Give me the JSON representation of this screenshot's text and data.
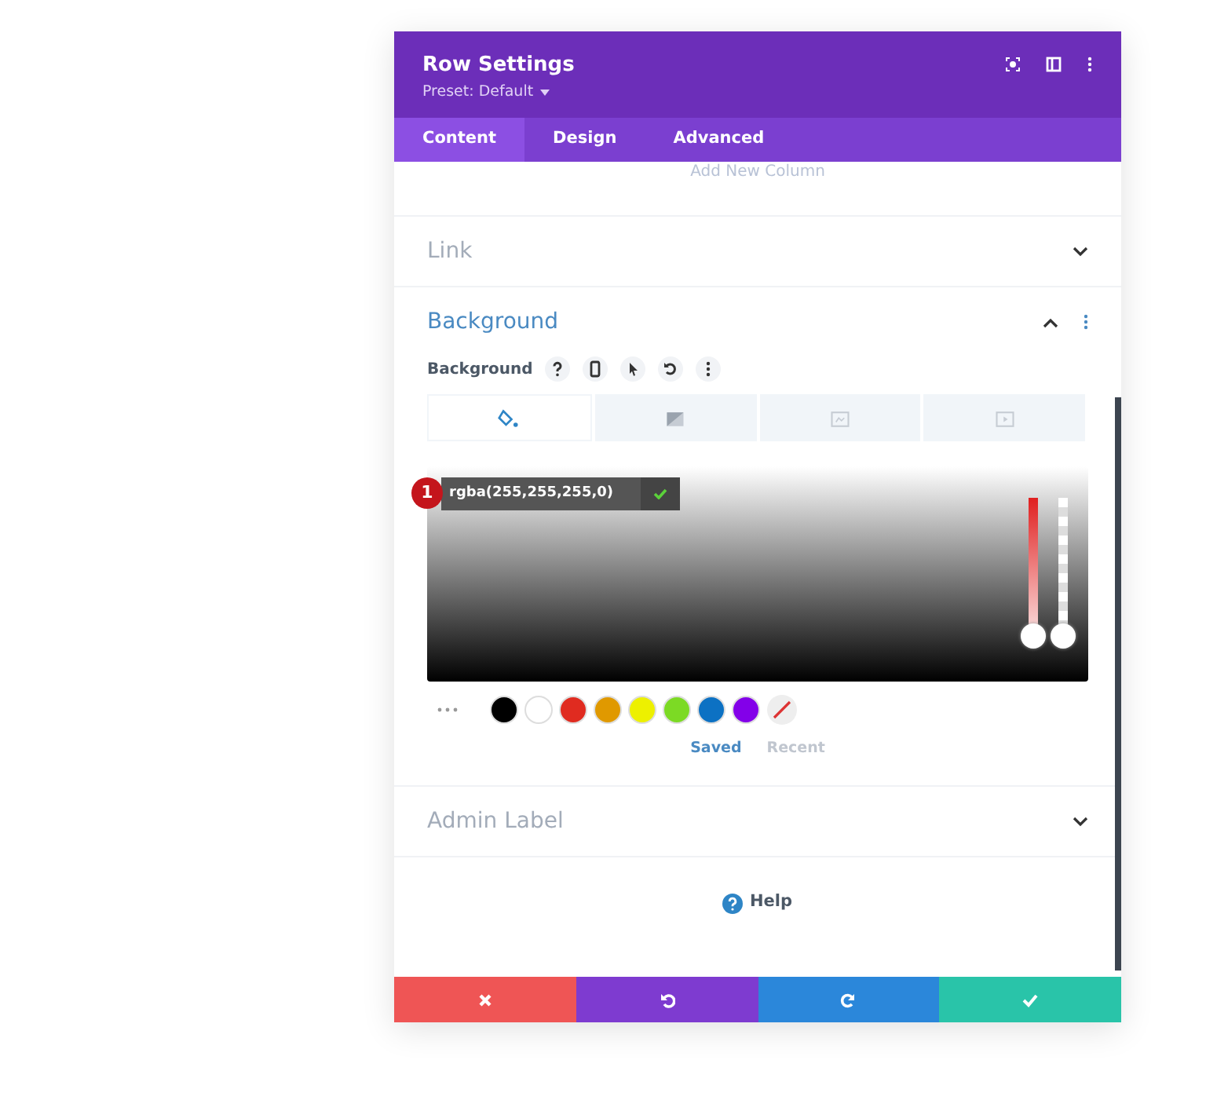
{
  "window": {
    "title": "Row Settings",
    "preset": "Preset: Default"
  },
  "tabs": [
    {
      "label": "Content",
      "selected": true
    },
    {
      "label": "Design",
      "selected": false
    },
    {
      "label": "Advanced",
      "selected": false
    }
  ],
  "clipped_text": "Add New Column",
  "sections": [
    {
      "title": "Link",
      "expanded": false
    },
    {
      "title": "Background",
      "expanded": true
    },
    {
      "title": "Admin Label",
      "expanded": false
    }
  ],
  "background": {
    "label": "Background",
    "types": [
      {
        "kind": "color",
        "selected": true
      },
      {
        "kind": "gradient",
        "selected": false
      },
      {
        "kind": "image",
        "selected": false
      },
      {
        "kind": "video",
        "selected": false
      }
    ],
    "color_value": "rgba(255,255,255,0)",
    "step_badge": "1",
    "sliders": [
      {
        "kind": "hue",
        "level": 0
      },
      {
        "kind": "alpha",
        "level": 0
      }
    ],
    "swatches": [
      {
        "color": "#000000"
      },
      {
        "color": "#ffffff"
      },
      {
        "color": "#e02b20"
      },
      {
        "color": "#e09900"
      },
      {
        "color": "#edf000"
      },
      {
        "color": "#7cda24"
      },
      {
        "color": "#0c71c3"
      },
      {
        "color": "#8300e9"
      },
      {
        "kind": "none"
      }
    ],
    "palette_tabs": [
      {
        "label": "Saved",
        "selected": true
      },
      {
        "label": "Recent",
        "selected": false
      }
    ]
  },
  "help": "Help",
  "footer": [
    {
      "kind": "cancel"
    },
    {
      "kind": "undo"
    },
    {
      "kind": "redo"
    },
    {
      "kind": "save"
    }
  ]
}
